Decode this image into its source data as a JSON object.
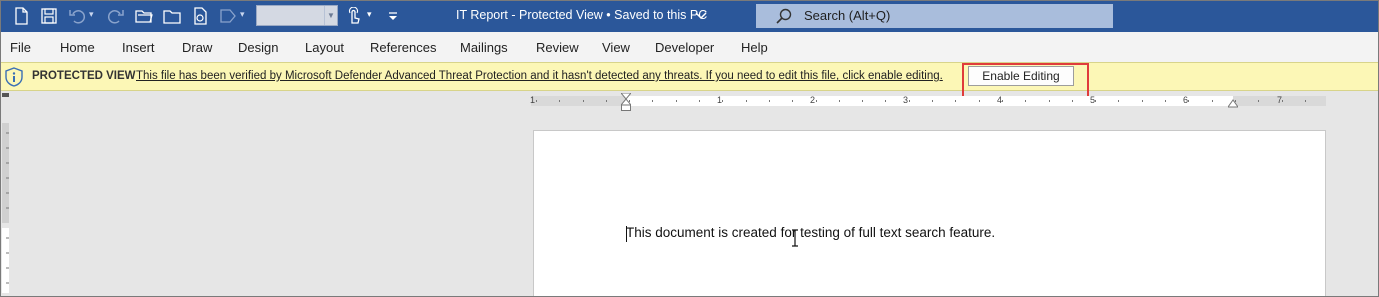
{
  "titlebar": {
    "doc_title": "IT Report  -  Protected View  •  Saved to this PC",
    "search_placeholder": "Search (Alt+Q)"
  },
  "menu": {
    "items": [
      "File",
      "Home",
      "Insert",
      "Draw",
      "Design",
      "Layout",
      "References",
      "Mailings",
      "Review",
      "View",
      "Developer",
      "Help"
    ]
  },
  "protected_view": {
    "title": "PROTECTED VIEW",
    "message": "This file has been verified by Microsoft Defender Advanced Threat Protection and it hasn't detected any threats. If you need to edit this file, click enable editing.",
    "button_label": "Enable Editing"
  },
  "ruler": {
    "labels": [
      "1",
      "1",
      "2",
      "3",
      "4",
      "5",
      "6",
      "7"
    ]
  },
  "document": {
    "text": "This document is created for testing of full text search feature."
  },
  "colors": {
    "titlebar": "#2b579a",
    "protected_bar": "#fcf7b6",
    "highlight": "#e03b3b"
  }
}
